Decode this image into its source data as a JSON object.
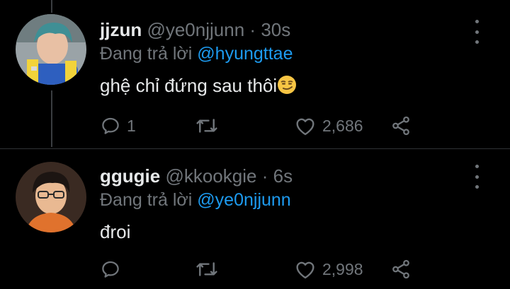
{
  "tweets": [
    {
      "name": "jjzun",
      "handle": "@ye0njjunn",
      "separator": "·",
      "time": "30s",
      "reply_prefix": "Đang trả lời",
      "reply_to": "@hyungttae",
      "text": "ghệ chỉ đứng sau thôi",
      "emoji": "smirking-face",
      "reply_count": "1",
      "retweet_count": "",
      "like_count": "2,686",
      "avatar_colors": {
        "hair": "#3f8f95",
        "shirt": "#2e5fbf",
        "vest": "#f2d33a",
        "bg": "#9aa3a7"
      }
    },
    {
      "name": "ggugie",
      "handle": "@kkookgie",
      "separator": "·",
      "time": "6s",
      "reply_prefix": "Đang trả lời",
      "reply_to": "@ye0njjunn",
      "text": "đroi",
      "reply_count": "",
      "retweet_count": "",
      "like_count": "2,998",
      "avatar_colors": {
        "hair": "#1c1512",
        "shirt": "#e0722d",
        "skin": "#e9b992",
        "bg": "#3a2a22"
      }
    }
  ],
  "colors": {
    "background": "#000000",
    "text": "#e7e9ea",
    "secondary": "#71767b",
    "mention": "#1d9bf0",
    "divider": "#2f3336"
  }
}
